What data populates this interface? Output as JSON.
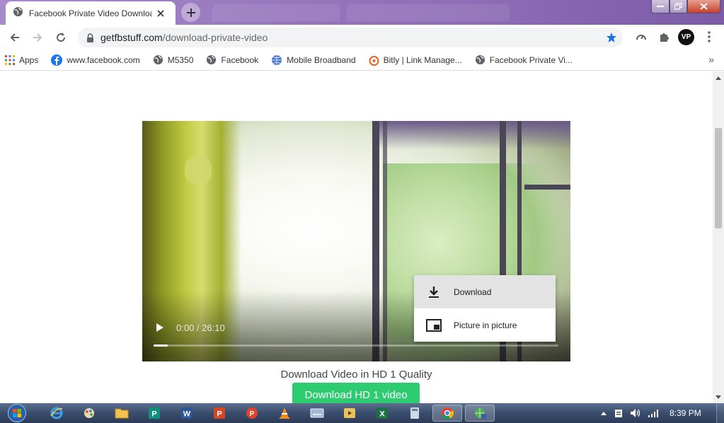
{
  "browser": {
    "tab_title": "Facebook Private Video Downloa",
    "url_host": "getfbstuff.com",
    "url_path": "/download-private-video",
    "avatar_initials": "VP"
  },
  "bookmarks": {
    "items": [
      {
        "label": "Apps",
        "icon": "apps-grid-icon"
      },
      {
        "label": "www.facebook.com",
        "icon": "facebook-icon"
      },
      {
        "label": "M5350",
        "icon": "globe-icon"
      },
      {
        "label": "Facebook",
        "icon": "globe-icon"
      },
      {
        "label": "Mobile Broadband",
        "icon": "globe-icon"
      },
      {
        "label": "Bitly | Link Manage...",
        "icon": "bitly-icon"
      },
      {
        "label": "Facebook Private Vi...",
        "icon": "globe-icon"
      }
    ],
    "more": "»"
  },
  "video": {
    "time": "0:00 / 26:10",
    "progress": 0.035,
    "menu": {
      "download_label": "Download",
      "pip_label": "Picture in picture"
    }
  },
  "page": {
    "quality_text": "Download Video in HD 1 Quality",
    "button_label": "Download HD 1 video"
  },
  "taskbar": {
    "time": "8:39 PM"
  },
  "colors": {
    "accent_green": "#2ecc71",
    "star_blue": "#1a73e8",
    "title_purple": "#9776bd"
  }
}
